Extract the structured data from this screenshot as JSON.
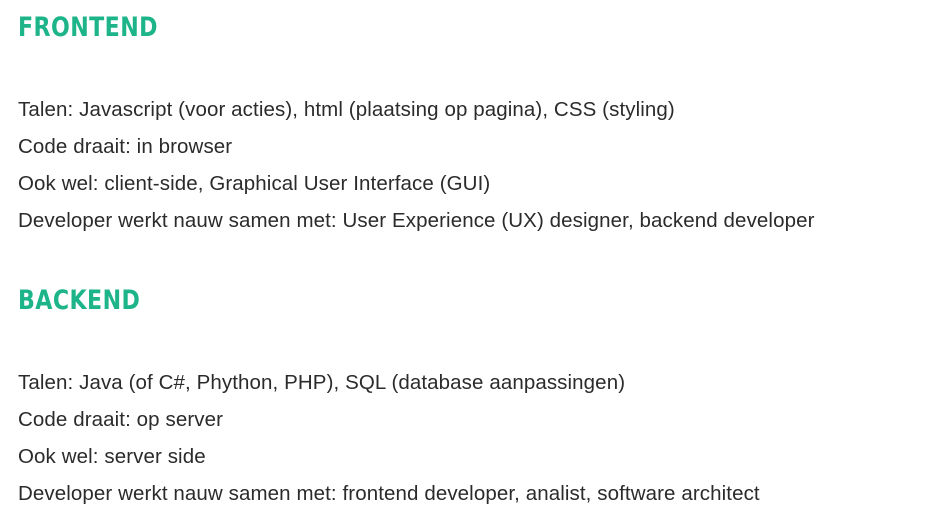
{
  "frontend": {
    "title": "FRONTEND",
    "lines": [
      "Talen: Javascript (voor acties), html (plaatsing op pagina), CSS (styling)",
      "Code draait: in browser",
      "Ook wel: client-side, Graphical User Interface (GUI)",
      "Developer werkt nauw samen met: User Experience (UX) designer, backend developer"
    ]
  },
  "backend": {
    "title": "BACKEND",
    "lines": [
      "Talen: Java (of C#, Phython, PHP), SQL (database aanpassingen)",
      "Code draait: op server",
      "Ook wel: server side",
      "Developer werkt nauw samen met: frontend developer, analist, software architect"
    ]
  },
  "colors": {
    "heading": "#1db48a",
    "text": "#2b2b2b",
    "background": "#ffffff"
  }
}
